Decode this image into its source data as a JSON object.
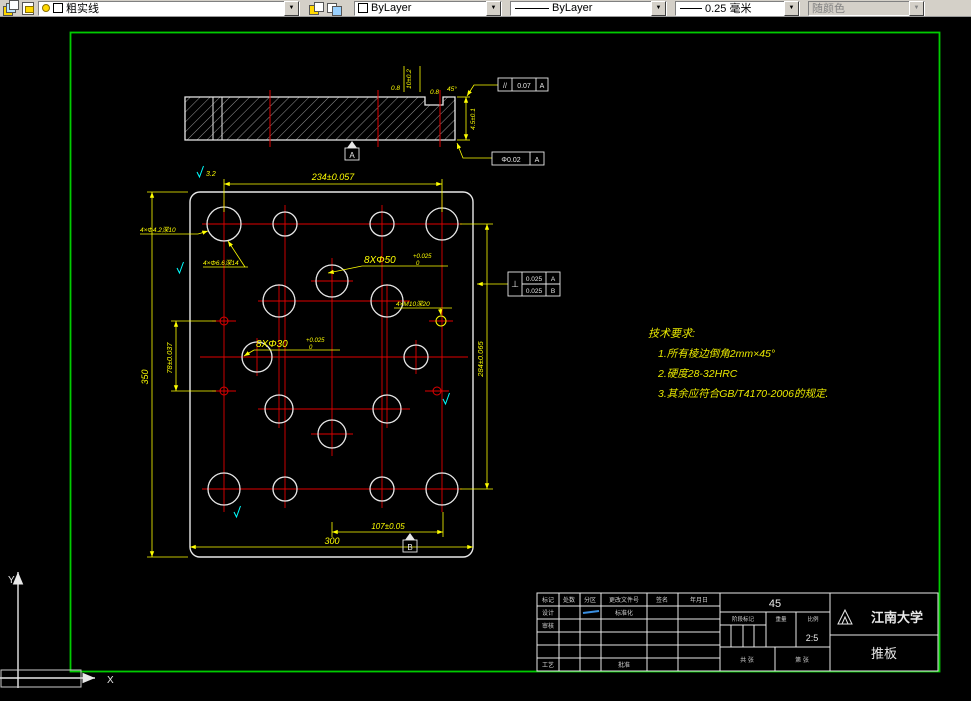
{
  "toolbar": {
    "layer": {
      "value": "粗实线"
    },
    "color": {
      "value": "ByLayer"
    },
    "linetype": {
      "value": "ByLayer"
    },
    "lineweight": {
      "value": "0.25 毫米"
    },
    "plotstyle": {
      "value": "随颜色"
    },
    "arrow": "▼"
  },
  "drawing": {
    "dims": {
      "top_width": "234±0.057",
      "overall_height": "350",
      "inner_left": "78±0.037",
      "inner_right": "284±0.065",
      "inner_bottom": "107±0.05",
      "bottom_width": "300",
      "rough_top": "3.2",
      "big_holes": "8XΦ50",
      "big_tol_u": "+0.025",
      "big_tol_l": "0",
      "small_holes": "8XΦ30",
      "small_tol_u": "+0.025",
      "small_tol_l": "0",
      "leader1": "4×Φ4.2深10",
      "leader2": "4×Φ6.6深14",
      "leader3": "4×M10深20",
      "sec_dim1": "10±0.2",
      "sec_rough1": "0.8",
      "sec_rough2": "0.8",
      "sec_dim2": "4.5±0.1",
      "sec_angle": "45°"
    },
    "gdt": {
      "para_sym": "//",
      "para_val": "0.07",
      "para_dat": "A",
      "run_val": "Φ0.02",
      "run_dat": "A",
      "perp_sym": "⊥",
      "perp_val1": "0.025",
      "perp_dat1": "A",
      "perp_val2": "0.025",
      "perp_dat2": "B",
      "datum_a": "A",
      "datum_b": "B"
    },
    "tech_req": {
      "title": "技术要求:",
      "item1": "1.所有棱边倒角2mm×45°",
      "item2": "2.硬度28-32HRC",
      "item3": "3.其余应符合GB/T4170-2006的规定."
    },
    "ucs": {
      "x_label": "X",
      "y_label": "Y"
    }
  },
  "titleblock": {
    "material": "45",
    "scale_value": "2:5",
    "university": "江南大学",
    "part_name": "推板",
    "labels": {
      "mark": "标记",
      "qty": "处数",
      "zone": "分区",
      "doc": "更改文件号",
      "sign": "签名",
      "date": "年月日",
      "design": "设计",
      "standard": "标准化",
      "check": "审核",
      "process": "工艺",
      "approve": "批准",
      "stage": "阶段标记",
      "weight": "重量",
      "ratio": "比例",
      "sheet_total": "共 张",
      "sheet_no": "第 张"
    }
  }
}
